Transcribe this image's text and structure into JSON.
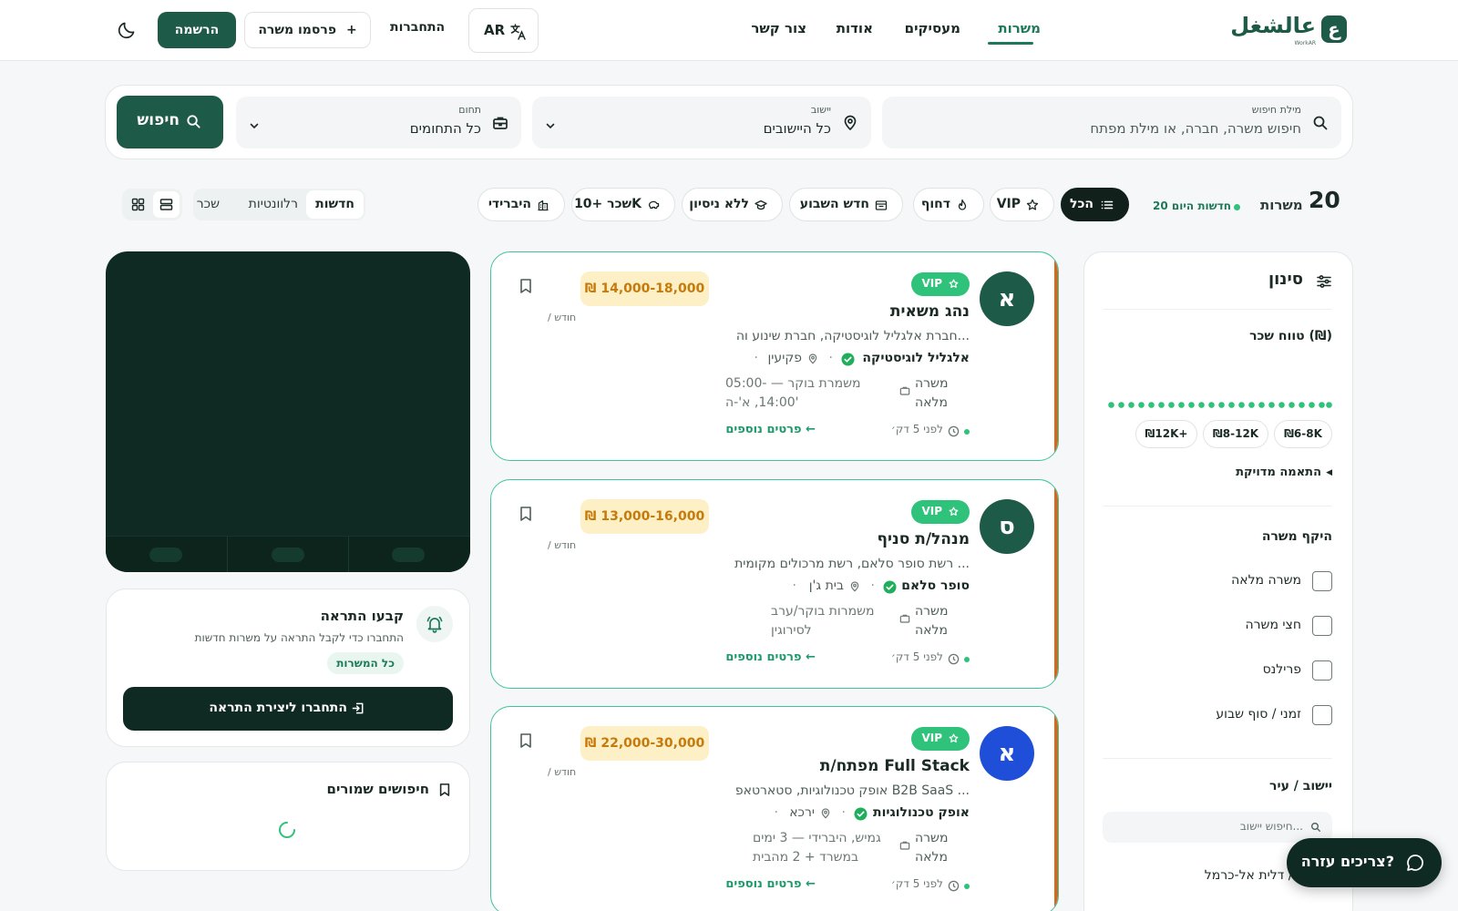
{
  "header": {
    "logo_letter": "ع",
    "logo_text": "عالشغل",
    "logo_sub": "WorkAR",
    "nav": [
      {
        "label": "משרות",
        "active": true
      },
      {
        "label": "מעסיקים",
        "active": false
      },
      {
        "label": "אודות",
        "active": false
      },
      {
        "label": "צור קשר",
        "active": false
      }
    ],
    "lang_label": "AR",
    "login_label": "התחברות",
    "post_label": "פרסמו משרה",
    "signup_label": "הרשמה"
  },
  "search": {
    "keyword": {
      "label": "מילת חיפוש",
      "placeholder": "חיפוש משרה, חברה, או מילת מפתח"
    },
    "city": {
      "label": "יישוב",
      "value": "כל היישובים"
    },
    "field": {
      "label": "תחום",
      "value": "כל התחומים"
    },
    "button_label": "חיפוש"
  },
  "toolbar": {
    "count": "20",
    "count_label": "משרות",
    "today_label": "20 חדשות היום",
    "chips": [
      {
        "label": "הכל",
        "active": true
      },
      {
        "label": "VIP",
        "active": false
      },
      {
        "label": "דחוף",
        "active": false
      },
      {
        "label": "חדש השבוע",
        "active": false
      },
      {
        "label": "ללא ניסיון",
        "active": false
      },
      {
        "label": "שכר +10K",
        "active": false
      },
      {
        "label": "היברידי",
        "active": false
      }
    ],
    "sort": [
      {
        "label": "חדשות",
        "active": true
      },
      {
        "label": "רלוונטיות",
        "active": false
      },
      {
        "label": "שכר",
        "active": false
      }
    ],
    "view_active": "list"
  },
  "filters": {
    "title": "סינון",
    "salary_heading": "טווח שכר (₪)",
    "salary_pills": [
      "₪6-8K",
      "₪8-12K",
      "₪12K+"
    ],
    "exact_match": "התאמה מדויקת",
    "scope_heading": "היקף משרה",
    "scope_options": [
      {
        "label": "משרה מלאה",
        "checked": false
      },
      {
        "label": "חצי משרה",
        "checked": false
      },
      {
        "label": "פרילנס",
        "checked": false
      },
      {
        "label": "זמני / סוף שבוע",
        "checked": false
      }
    ],
    "city_heading": "יישוב / עיר",
    "city_placeholder": "חיפוש יישוב...",
    "city_first": "עספיא / דלית אל-כרמל"
  },
  "jobs": [
    {
      "avatar": "א",
      "avatar_color": "#1d5a47",
      "vip": "VIP",
      "title": "נהג משאית",
      "description": "חברת אלגליל לוגיסטיקה, חברת שינוע וה...",
      "company": "אלגליל לוגיסטיקה",
      "location": "פקיעין",
      "type": "משרה מלאה",
      "shift": "משמרת בוקר — 05:00-14:00, א'-ה'",
      "posted": "לפני 5 דק׳",
      "more": "פרטים נוספים",
      "salary": "₪ 14,000-18,000",
      "per": "/ חודש"
    },
    {
      "avatar": "ס",
      "avatar_color": "#1d5a47",
      "vip": "VIP",
      "title": "מנהל/ת סניף",
      "description": "רשת סופר סלאם, רשת מרכולים מקומית ...",
      "company": "סופר סלאם",
      "location": "בית ג'ן",
      "type": "משרה מלאה",
      "shift": "משמרות בוקר/ערב לסירוגין",
      "posted": "לפני 5 דק׳",
      "more": "פרטים נוספים",
      "salary": "₪ 13,000-16,000",
      "per": "/ חודש"
    },
    {
      "avatar": "א",
      "avatar_color": "#1f4fd8",
      "vip": "VIP",
      "title": "מפתח/ת Full Stack",
      "description": "אופק טכנולוגיות, סטארטאפ B2B SaaS ...",
      "company": "אופק טכנולוגיות",
      "location": "ירכא",
      "type": "משרה מלאה",
      "shift": "גמיש, היברידי — 3 ימים במשרד + 2 מהבית",
      "posted": "לפני 5 דק׳",
      "more": "פרטים נוספים",
      "salary": "₪ 22,000-30,000",
      "per": "/ חודש"
    }
  ],
  "alert": {
    "title": "קבעו התראה",
    "subtitle": "התחברו כדי לקבל התראה על משרות חדשות",
    "chip": "כל המשרות",
    "button": "התחברו ליצירת התראה"
  },
  "saved": {
    "title": "חיפושים שמורים"
  },
  "help": {
    "label": "צריכים עזרה?"
  },
  "colors": {
    "brand": "#1d5a47",
    "accent": "#2fc27a",
    "salary_bg": "#fdefc6",
    "salary_text": "#c77a0a",
    "card_border": "#41c39c",
    "card_stripe": "#d2691e"
  }
}
